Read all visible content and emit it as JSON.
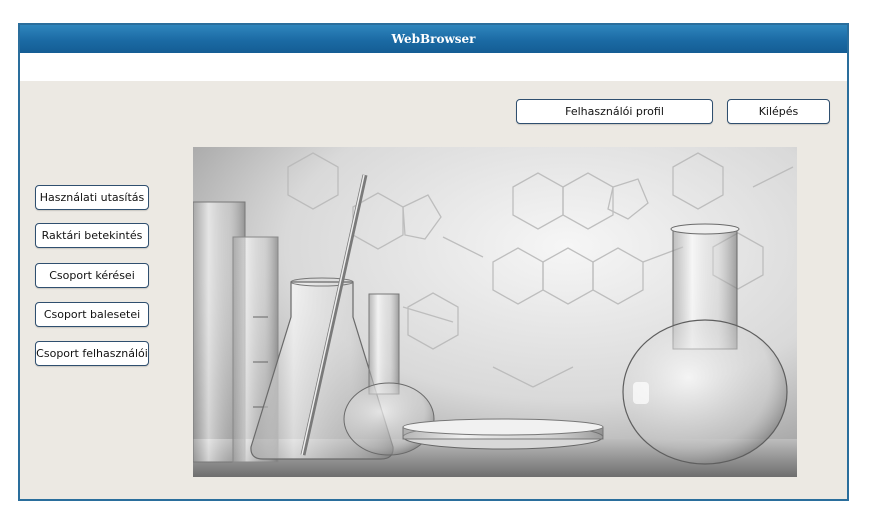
{
  "window": {
    "title": "WebBrowser"
  },
  "header_buttons": {
    "profile": "Felhasználói profil",
    "logout": "Kilépés"
  },
  "sidebar": {
    "items": [
      {
        "label": "Használati utasítás"
      },
      {
        "label": "Raktári betekintés"
      },
      {
        "label": "Csoport kérései"
      },
      {
        "label": "Csoport balesetei"
      },
      {
        "label": "Csoport felhasználói"
      }
    ]
  },
  "colors": {
    "titlebar": "#1b6aa4",
    "content_bg": "#ece9e3",
    "button_border": "#2f4f6f"
  }
}
